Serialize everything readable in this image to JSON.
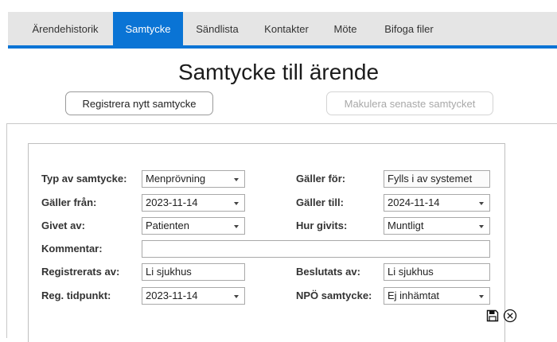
{
  "tabs": [
    {
      "label": "Ärendehistorik",
      "active": false
    },
    {
      "label": "Samtycke",
      "active": true
    },
    {
      "label": "Sändlista",
      "active": false
    },
    {
      "label": "Kontakter",
      "active": false
    },
    {
      "label": "Möte",
      "active": false
    },
    {
      "label": "Bifoga filer",
      "active": false
    }
  ],
  "page": {
    "title": "Samtycke till ärende",
    "register_button": "Registrera nytt samtycke",
    "cancel_button": "Makulera senaste samtycket"
  },
  "form": {
    "type": {
      "label": "Typ av samtycke:",
      "value": "Menprövning"
    },
    "applies_to": {
      "label": "Gäller för:",
      "value": "Fylls i av systemet"
    },
    "valid_from": {
      "label": "Gäller från:",
      "value": "2023-11-14"
    },
    "valid_to": {
      "label": "Gäller till:",
      "value": "2024-11-14"
    },
    "given_by": {
      "label": "Givet av:",
      "value": "Patienten"
    },
    "how_given": {
      "label": "Hur givits:",
      "value": "Muntligt"
    },
    "comment": {
      "label": "Kommentar:",
      "value": ""
    },
    "registered_by": {
      "label": "Registrerats av:",
      "value": "Li sjukhus"
    },
    "decided_by": {
      "label": "Beslutats av:",
      "value": "Li sjukhus"
    },
    "reg_time": {
      "label": "Reg. tidpunkt:",
      "value": "2023-11-14"
    },
    "npo_consent": {
      "label": "NPÖ samtycke:",
      "value": "Ej inhämtat"
    }
  },
  "colors": {
    "accent": "#0a74d5",
    "tabbar_bg": "#e5e5e5"
  },
  "icons": [
    "save-icon",
    "close-circle-icon"
  ]
}
